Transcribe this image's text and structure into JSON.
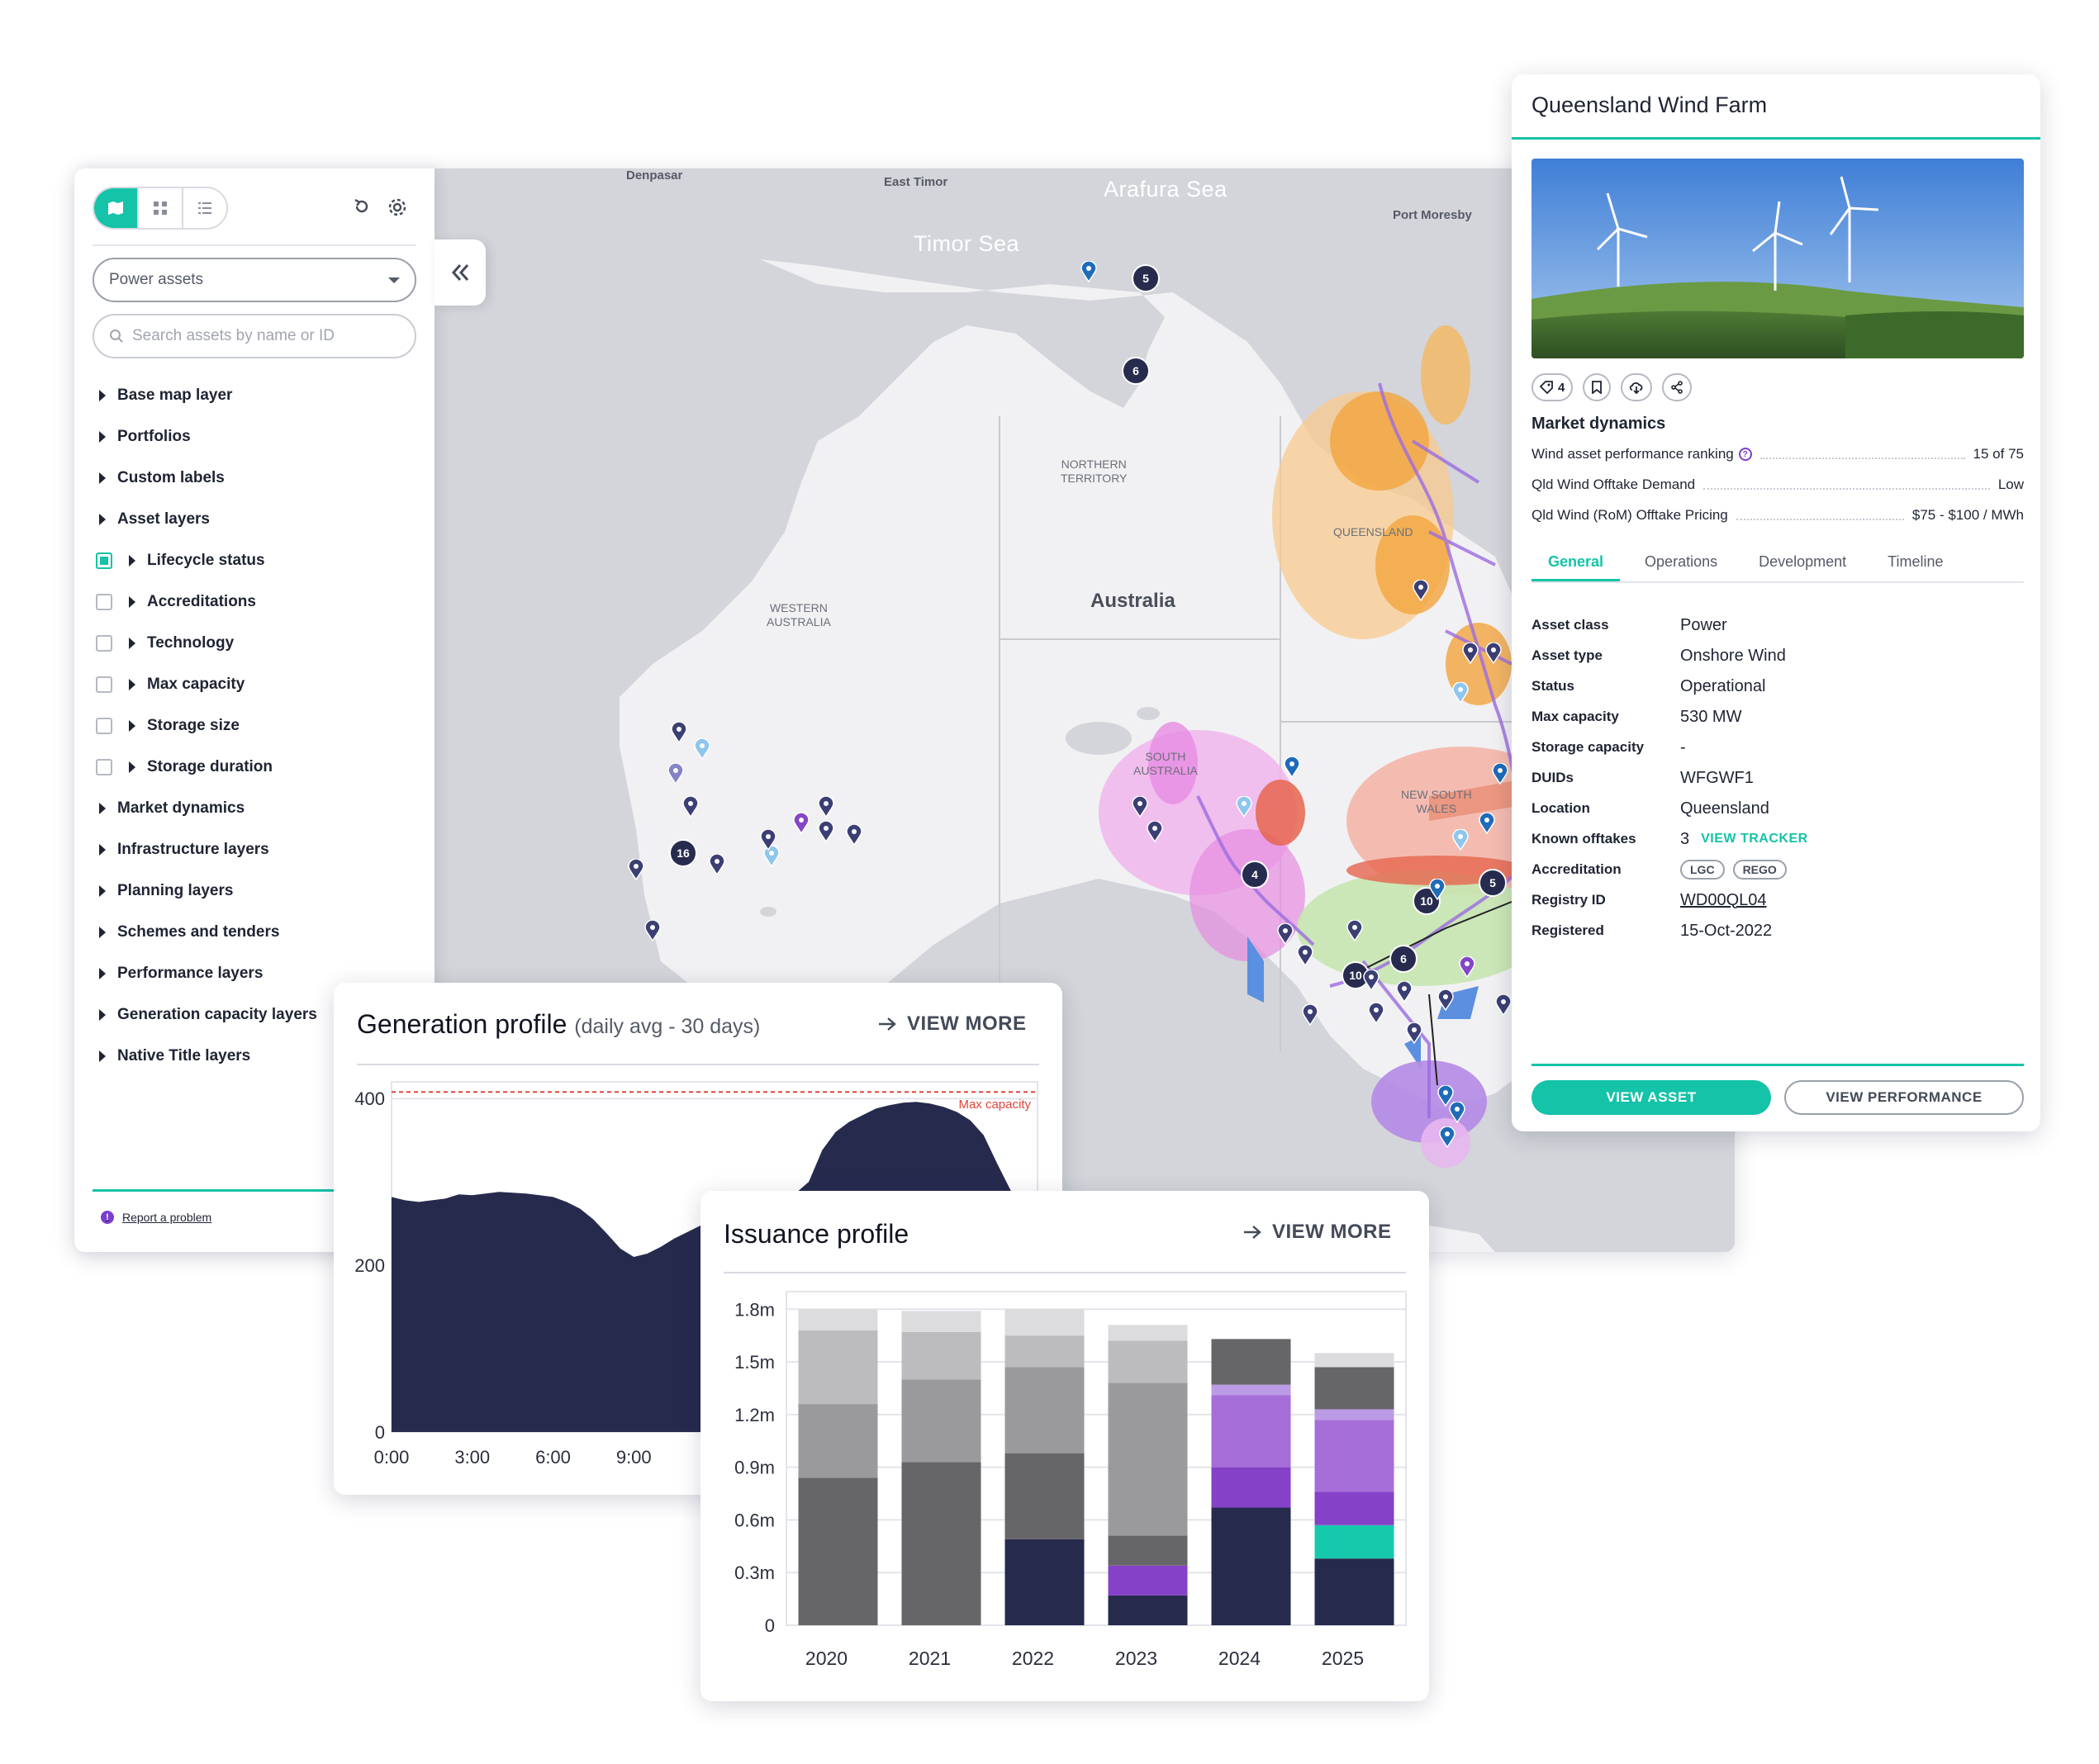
{
  "map": {
    "places": [
      {
        "id": "denpasar",
        "label": "Denpasar"
      },
      {
        "id": "east-timor",
        "label": "East Timor"
      },
      {
        "id": "port-moresby",
        "label": "Port Moresby"
      }
    ],
    "seas": [
      {
        "id": "arafura",
        "label": "Arafura Sea"
      },
      {
        "id": "timor",
        "label": "Timor Sea"
      }
    ],
    "regions": [
      {
        "id": "northern-territory",
        "label": "NORTHERN\nTERRITORY"
      },
      {
        "id": "western-australia",
        "label": "WESTERN\nAUSTRALIA"
      },
      {
        "id": "queensland",
        "label": "QUEENSLAND"
      },
      {
        "id": "south-australia",
        "label": "SOUTH\nAUSTRALIA"
      },
      {
        "id": "new-south-wales",
        "label": "NEW SOUTH\nWALES"
      }
    ],
    "country": "Australia",
    "clusters": [
      "5",
      "6",
      "16",
      "4",
      "10",
      "5",
      "10",
      "6"
    ]
  },
  "sidebar": {
    "view_modes": [
      "map-icon",
      "grid-icon",
      "list-icon"
    ],
    "asset_select": "Power assets",
    "search_placeholder": "Search assets by name or ID",
    "layers": [
      {
        "label": "Base map layer",
        "type": "group"
      },
      {
        "label": "Portfolios",
        "type": "group"
      },
      {
        "label": "Custom labels",
        "type": "group"
      },
      {
        "label": "Asset layers",
        "type": "group"
      },
      {
        "label": "Lifecycle status",
        "type": "sub",
        "checked": true
      },
      {
        "label": "Accreditations",
        "type": "sub",
        "checked": false
      },
      {
        "label": "Technology",
        "type": "sub",
        "checked": false
      },
      {
        "label": "Max capacity",
        "type": "sub",
        "checked": false
      },
      {
        "label": "Storage size",
        "type": "sub",
        "checked": false
      },
      {
        "label": "Storage duration",
        "type": "sub",
        "checked": false
      },
      {
        "label": "Market dynamics",
        "type": "group"
      },
      {
        "label": "Infrastructure layers",
        "type": "group"
      },
      {
        "label": "Planning layers",
        "type": "group"
      },
      {
        "label": "Schemes and tenders",
        "type": "group"
      },
      {
        "label": "Performance layers",
        "type": "group"
      },
      {
        "label": "Generation capacity layers",
        "type": "group"
      },
      {
        "label": "Native Title layers",
        "type": "group"
      }
    ],
    "report_label": "Report a problem"
  },
  "detail": {
    "title": "Queensland Wind Farm",
    "tag_count": "4",
    "market_section": "Market dynamics",
    "market": [
      {
        "label": "Wind asset performance ranking",
        "value": "15 of 75",
        "help": true
      },
      {
        "label": "Qld Wind Offtake Demand",
        "value": "Low",
        "help": false
      },
      {
        "label": "Qld Wind (RoM) Offtake Pricing",
        "value": "$75 - $100 / MWh",
        "help": false
      }
    ],
    "tabs": [
      "General",
      "Operations",
      "Development",
      "Timeline"
    ],
    "active_tab": "General",
    "fields": {
      "asset_class": {
        "k": "Asset class",
        "v": "Power"
      },
      "asset_type": {
        "k": "Asset type",
        "v": "Onshore Wind"
      },
      "status": {
        "k": "Status",
        "v": "Operational"
      },
      "max_capacity": {
        "k": "Max capacity",
        "v": "530 MW"
      },
      "storage_capacity": {
        "k": "Storage capacity",
        "v": "-"
      },
      "duids": {
        "k": "DUIDs",
        "v": "WFGWF1"
      },
      "location": {
        "k": "Location",
        "v": "Queensland"
      },
      "known_offtakes": {
        "k": "Known offtakes",
        "v": "3",
        "link": "VIEW TRACKER"
      },
      "accreditation": {
        "k": "Accreditation",
        "chips": [
          "LGC",
          "REGO"
        ]
      },
      "registry_id": {
        "k": "Registry ID",
        "v": "WD00QL04"
      },
      "registered": {
        "k": "Registered",
        "v": "15-Oct-2022"
      }
    },
    "btn_asset": "VIEW ASSET",
    "btn_performance": "VIEW PERFORMANCE"
  },
  "generation": {
    "title": "Generation profile",
    "subtitle": "(daily avg - 30 days)",
    "view_more": "VIEW MORE"
  },
  "issuance": {
    "title": "Issuance profile",
    "view_more": "VIEW MORE"
  },
  "colors": {
    "accent": "#14c3a8",
    "navy": "#262a4d",
    "purple": "#7b3ed0"
  },
  "chart_data": [
    {
      "type": "area",
      "title": "Generation profile",
      "subtitle": "(daily avg - 30 days)",
      "y_ticks": [
        0,
        200,
        400
      ],
      "ylim": [
        0,
        420
      ],
      "x_ticks": [
        "0:00",
        "3:00",
        "6:00",
        "9:00"
      ],
      "x_hours": [
        0,
        0.5,
        1,
        1.5,
        2,
        2.5,
        3,
        3.5,
        4,
        4.5,
        5,
        5.5,
        6,
        6.5,
        7,
        7.5,
        8,
        8.5,
        9,
        9.5,
        10,
        10.5,
        11,
        11.5,
        12,
        12.5,
        13,
        13.5,
        14,
        14.5,
        15,
        15.5,
        16,
        16.5,
        17,
        17.5,
        18,
        18.5,
        19,
        19.5,
        20,
        20.5,
        21,
        21.5,
        22,
        22.5,
        23,
        23.5,
        24
      ],
      "values": [
        282,
        278,
        276,
        278,
        280,
        285,
        284,
        286,
        288,
        287,
        286,
        284,
        282,
        276,
        268,
        255,
        238,
        220,
        210,
        214,
        222,
        232,
        240,
        248,
        255,
        262,
        268,
        274,
        278,
        282,
        286,
        300,
        338,
        360,
        372,
        380,
        388,
        392,
        395,
        396,
        394,
        390,
        384,
        374,
        356,
        322,
        290,
        270,
        255
      ],
      "reference_line": {
        "label": "Max capacity",
        "value": 400
      }
    },
    {
      "type": "bar",
      "title": "Issuance profile",
      "categories": [
        "2020",
        "2021",
        "2022",
        "2023",
        "2024",
        "2025"
      ],
      "y_ticks": [
        "0",
        "0.3m",
        "0.6m",
        "0.9m",
        "1.2m",
        "1.5m",
        "1.8m"
      ],
      "ylim": [
        0,
        1.9
      ],
      "stack_colors": [
        "#262a4d",
        "#16c9ad",
        "#8541c7",
        "#a66ed8",
        "#bb9ae6",
        "#666669",
        "#9a9a9d",
        "#bcbcbf",
        "#dcdcde"
      ],
      "stacks": [
        [
          0,
          0,
          0,
          0,
          0,
          0.84,
          0.42,
          0.42,
          0.12
        ],
        [
          0,
          0,
          0,
          0,
          0,
          0.93,
          0.47,
          0.27,
          0.12
        ],
        [
          0.49,
          0,
          0,
          0,
          0,
          0.49,
          0.49,
          0.18,
          0.15
        ],
        [
          0.17,
          0,
          0.17,
          0,
          0,
          0.17,
          0.87,
          0.24,
          0.09
        ],
        [
          0.67,
          0,
          0.23,
          0.41,
          0.06,
          0.26,
          0,
          0,
          0
        ],
        [
          0.38,
          0.19,
          0.19,
          0.41,
          0.06,
          0.24,
          0,
          0,
          0.08
        ]
      ]
    }
  ]
}
